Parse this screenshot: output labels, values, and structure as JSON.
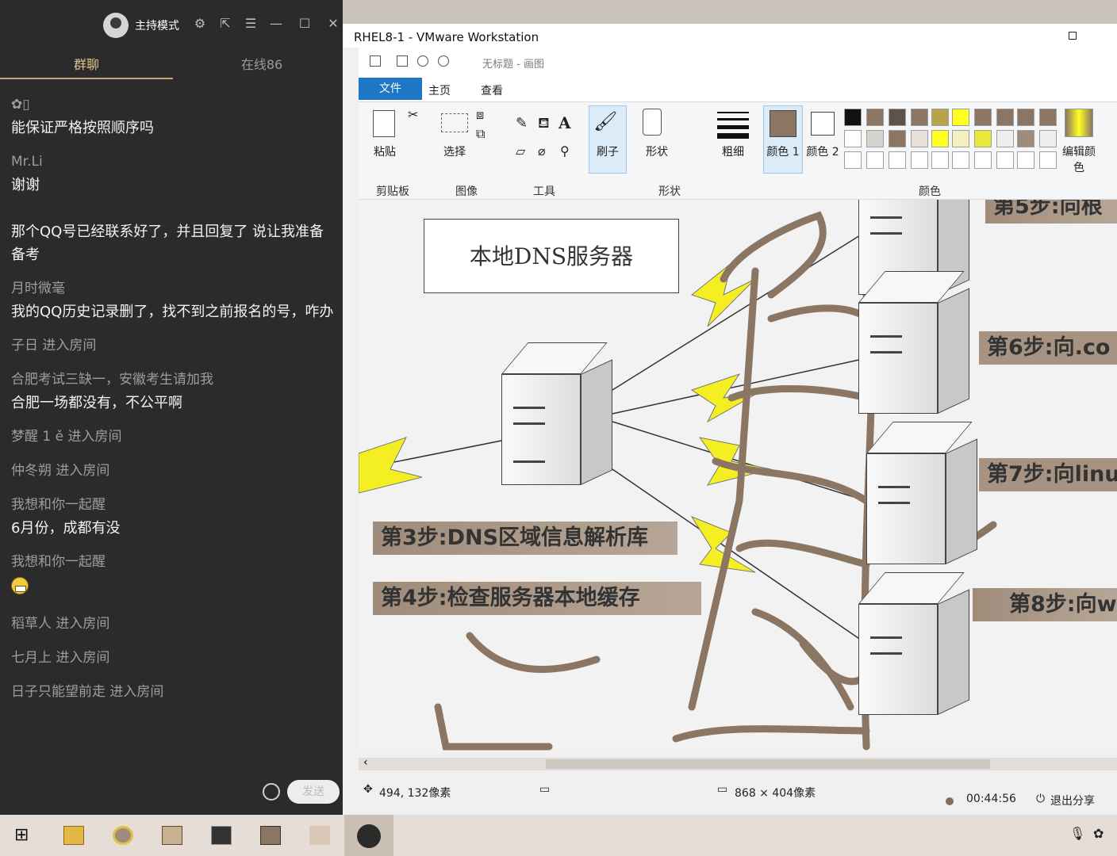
{
  "chat": {
    "host_label": "主持模式",
    "tabs": {
      "group": "群聊",
      "online": "在线86"
    },
    "messages": [
      {
        "name": "",
        "text": "能保证严格按照顺序吗"
      },
      {
        "name": "Mr.Li",
        "text": "谢谢"
      },
      {
        "name": "",
        "text": "那个QQ号已经联系好了，并且回复了 说让我准备备考"
      },
      {
        "name": "月时微毫",
        "text": "我的QQ历史记录删了，找不到之前报名的号，咋办"
      },
      {
        "name": "子日 进入房间",
        "text": ""
      },
      {
        "name": "合肥考试三缺一，安徽考生请加我",
        "text": "合肥一场都没有，不公平啊"
      },
      {
        "name": "梦醒 1 ě 进入房间",
        "text": ""
      },
      {
        "name": "仲冬朔 进入房间",
        "text": ""
      },
      {
        "name": "我想和你一起醒",
        "text": "6月份，成都有没"
      },
      {
        "name": "我想和你一起醒",
        "text": ""
      },
      {
        "name": "稻草人 进入房间",
        "text": ""
      },
      {
        "name": "七月上 进入房间",
        "text": ""
      },
      {
        "name": "日子只能望前走 进入房间",
        "text": ""
      }
    ],
    "send_label": "发送"
  },
  "vm": {
    "title": "RHEL8-1 - VMware Workstation",
    "paint_title": "无标题 - 画图",
    "ribbon_tabs": {
      "file": "文件",
      "home": "主页",
      "view": "查看"
    },
    "tools": {
      "paste": "粘贴",
      "select": "选择",
      "brush": "刷子",
      "shape": "形状",
      "size": "粗细",
      "color1": "颜色 1",
      "color2": "颜色 2",
      "edit_colors": "编辑颜色"
    },
    "groups": {
      "clipboard": "剪贴板",
      "image": "图像",
      "tools": "工具",
      "shapes": "形状",
      "colors": "颜色"
    },
    "canvas": {
      "dns_box": "本地DNS服务器",
      "step3": "第3步:DNS区域信息解析库",
      "step4": "第4步:检查服务器本地缓存",
      "step5": "第5步:向根",
      "step6": "第6步:向.co",
      "step7": "第7步:向linu",
      "step8": "第8步:向w"
    },
    "status": {
      "cursor_pos": "494, 132像素",
      "image_size": "868 × 404像素",
      "timer": "00:44:56",
      "exit_share": "退出分享"
    }
  },
  "colors": {
    "accent": "#1e76c6",
    "chat_bg": "#2b2b2b",
    "tab_active": "#e6c28c",
    "annotation": "#8b7563"
  }
}
